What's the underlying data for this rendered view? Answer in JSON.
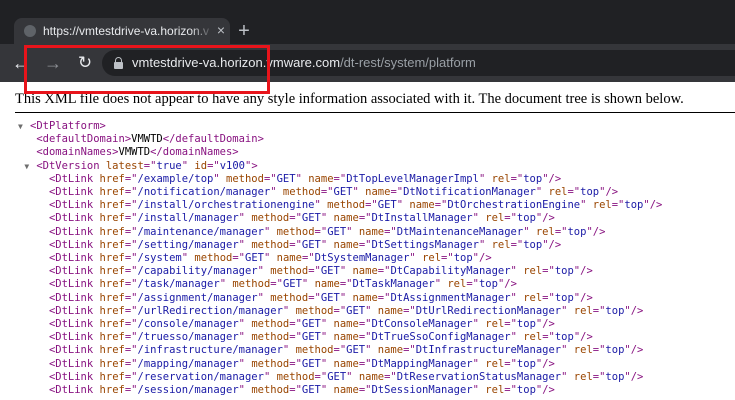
{
  "browser": {
    "tab_title": "https://vmtestdrive-va.horizon.vmware.com/dt-rest/system/platform",
    "tab_close_glyph": "×",
    "new_tab_glyph": "+",
    "back_glyph": "←",
    "forward_glyph": "→",
    "reload_glyph": "↻",
    "url_host": "vmtestdrive-va.horizon.vmware.com",
    "url_path": "/dt-rest/system/platform"
  },
  "page": {
    "info_message": "This XML file does not appear to have any style information associated with it. The document tree is shown below."
  },
  "xml": {
    "root_tag": "DtPlatform",
    "default_domain": "VMWTD",
    "domain_names": "VMWTD",
    "version": {
      "latest": "true",
      "id": "v100"
    },
    "links": [
      {
        "href": "/example/top",
        "method": "GET",
        "name": "DtTopLevelManagerImpl",
        "rel": "top"
      },
      {
        "href": "/notification/manager",
        "method": "GET",
        "name": "DtNotificationManager",
        "rel": "top"
      },
      {
        "href": "/install/orchestrationengine",
        "method": "GET",
        "name": "DtOrchestrationEngine",
        "rel": "top"
      },
      {
        "href": "/install/manager",
        "method": "GET",
        "name": "DtInstallManager",
        "rel": "top"
      },
      {
        "href": "/maintenance/manager",
        "method": "GET",
        "name": "DtMaintenanceManager",
        "rel": "top"
      },
      {
        "href": "/setting/manager",
        "method": "GET",
        "name": "DtSettingsManager",
        "rel": "top"
      },
      {
        "href": "/system",
        "method": "GET",
        "name": "DtSystemManager",
        "rel": "top"
      },
      {
        "href": "/capability/manager",
        "method": "GET",
        "name": "DtCapabilityManager",
        "rel": "top"
      },
      {
        "href": "/task/manager",
        "method": "GET",
        "name": "DtTaskManager",
        "rel": "top"
      },
      {
        "href": "/assignment/manager",
        "method": "GET",
        "name": "DtAssignmentManager",
        "rel": "top"
      },
      {
        "href": "/urlRedirection/manager",
        "method": "GET",
        "name": "DtUrlRedirectionManager",
        "rel": "top"
      },
      {
        "href": "/console/manager",
        "method": "GET",
        "name": "DtConsoleManager",
        "rel": "top"
      },
      {
        "href": "/truesso/manager",
        "method": "GET",
        "name": "DtTrueSsoConfigManager",
        "rel": "top"
      },
      {
        "href": "/infrastructure/manager",
        "method": "GET",
        "name": "DtInfrastructureManager",
        "rel": "top"
      },
      {
        "href": "/mapping/manager",
        "method": "GET",
        "name": "DtMappingManager",
        "rel": "top"
      },
      {
        "href": "/reservation/manager",
        "method": "GET",
        "name": "DtReservationStatusManager",
        "rel": "top"
      },
      {
        "href": "/session/manager",
        "method": "GET",
        "name": "DtSessionManager",
        "rel": "top"
      }
    ]
  },
  "colors": {
    "highlight_box": "#e8141b",
    "tag": "#881280",
    "attr_name": "#994500",
    "attr_value": "#1a1aa6"
  }
}
